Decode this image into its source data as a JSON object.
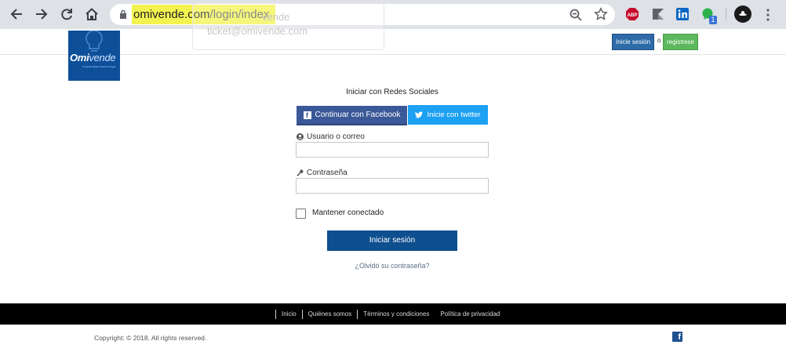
{
  "browser": {
    "url_host": "omivende.com",
    "url_path": "/login/index",
    "ghost_line1": "vende",
    "ghost_line2": "ticket@omivende.com",
    "ext_badge": "1",
    "highlight_color": "#f3f350",
    "icons": [
      "back-icon",
      "forward-icon",
      "reload-icon",
      "home-icon",
      "lock-icon",
      "zoom-icon",
      "star-icon",
      "adblock-icon",
      "flag-icon",
      "linkedin-icon",
      "chat-icon",
      "avatar",
      "menu-icon"
    ]
  },
  "header": {
    "logo_main": "Omi",
    "logo_sub": "vende",
    "logo_tagline": "Compras fáciles desde tu hogar",
    "login_label": "Inicie sesión",
    "or_label": "o",
    "register_label": "registrese"
  },
  "form": {
    "social_title": "Iniciar con Redes Sociales",
    "facebook_label": "Continuar con Facebook",
    "twitter_label": "Inicie con twitter",
    "user_label": "Usuario o correo",
    "user_value": "",
    "password_label": "Contraseña",
    "password_value": "",
    "remember_label": "Mantener conectado",
    "remember_checked": false,
    "submit_label": "Iniciar sesión",
    "forgot_label": "¿Olvidó su contraseña?"
  },
  "footer": {
    "links": [
      "Inicio",
      "Quiénes somos",
      "Términos y condiciones",
      "Política de privacidad"
    ],
    "copyright": "Copyright: © 2018. All rights reserved."
  },
  "colors": {
    "brand_blue": "#0e4f9a",
    "facebook": "#3b5998",
    "twitter": "#1da1f2",
    "register_green": "#5cb85c"
  }
}
